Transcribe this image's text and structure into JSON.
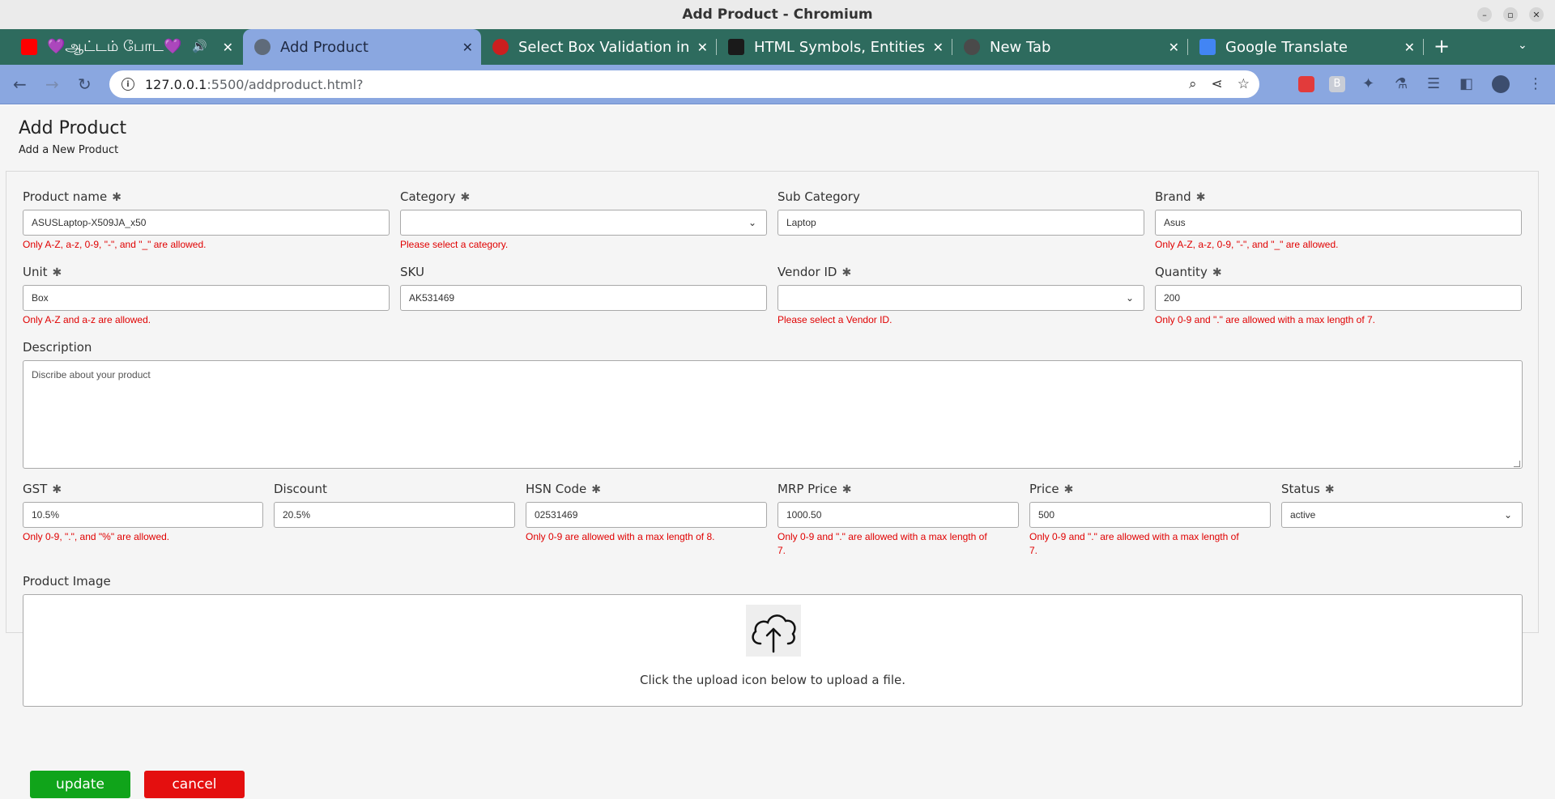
{
  "window": {
    "title": "Add Product - Chromium"
  },
  "tabs": [
    {
      "label": "💜ஆட்டம் போட💜",
      "favicon_color": "#ff0000",
      "active": false
    },
    {
      "label": "Add Product",
      "favicon_color": "#5f6b7a",
      "active": true
    },
    {
      "label": "Select Box Validation in",
      "favicon_color": "#cc1f1f",
      "active": false
    },
    {
      "label": "HTML Symbols, Entities",
      "favicon_color": "#1a1a1a",
      "active": false
    },
    {
      "label": "New Tab",
      "favicon_color": "#4a4a4a",
      "active": false
    },
    {
      "label": "Google Translate",
      "favicon_color": "#4285f4",
      "active": false
    }
  ],
  "address": {
    "host": "127.0.0.1",
    "rest": ":5500/addproduct.html?"
  },
  "page": {
    "title": "Add Product",
    "subtitle": "Add a New Product"
  },
  "fields": {
    "product_name": {
      "label": "Product name",
      "required": "✱",
      "value": "ASUSLaptop-X509JA_x50",
      "error": "Only A-Z, a-z, 0-9, \"-\", and \"_\" are allowed."
    },
    "category": {
      "label": "Category",
      "required": "✱",
      "value": "",
      "error": "Please select a category."
    },
    "sub_category": {
      "label": "Sub Category",
      "value": "Laptop"
    },
    "brand": {
      "label": "Brand",
      "required": "✱",
      "value": "Asus",
      "error": "Only A-Z, a-z, 0-9, \"-\", and \"_\" are allowed."
    },
    "unit": {
      "label": "Unit",
      "required": "✱",
      "value": "Box",
      "error": "Only A-Z and a-z are allowed."
    },
    "sku": {
      "label": "SKU",
      "value": "AK531469"
    },
    "vendor_id": {
      "label": "Vendor ID",
      "required": "✱",
      "value": "",
      "error": "Please select a Vendor ID."
    },
    "quantity": {
      "label": "Quantity",
      "required": "✱",
      "value": "200",
      "error": "Only 0-9 and \".\" are allowed with a max length of 7."
    },
    "description": {
      "label": "Description",
      "placeholder": "Discribe about your product"
    },
    "gst": {
      "label": "GST",
      "required": "✱",
      "value": "10.5%",
      "error": "Only 0-9, \".\", and \"%\" are allowed."
    },
    "discount": {
      "label": "Discount",
      "value": "20.5%"
    },
    "hsn_code": {
      "label": "HSN Code",
      "required": "✱",
      "value": "02531469",
      "error": "Only 0-9 are allowed with a max length of 8."
    },
    "mrp_price": {
      "label": "MRP Price",
      "required": "✱",
      "value": "1000.50",
      "error_line1": "Only 0-9 and \".\" are allowed with a max length of",
      "error_line2": "7."
    },
    "price": {
      "label": "Price",
      "required": "✱",
      "value": "500",
      "error_line1": "Only 0-9 and \".\" are allowed with a max length of",
      "error_line2": "7."
    },
    "status": {
      "label": "Status",
      "required": "✱",
      "value": "active"
    },
    "product_image": {
      "label": "Product Image",
      "upload_text": "Click the upload icon below to upload a file."
    }
  },
  "buttons": {
    "update": "update",
    "cancel": "cancel"
  },
  "colors": {
    "error": "#e00000",
    "update": "#10a41a",
    "cancel": "#e40f0f",
    "tab_strip": "#2e6b5e",
    "toolbar": "#8aa7e0"
  },
  "icons": [
    "back-icon",
    "forward-icon",
    "reload-icon",
    "info-icon",
    "zoom-icon",
    "share-icon",
    "star-icon",
    "extensions-icon",
    "upload-cloud-icon"
  ]
}
